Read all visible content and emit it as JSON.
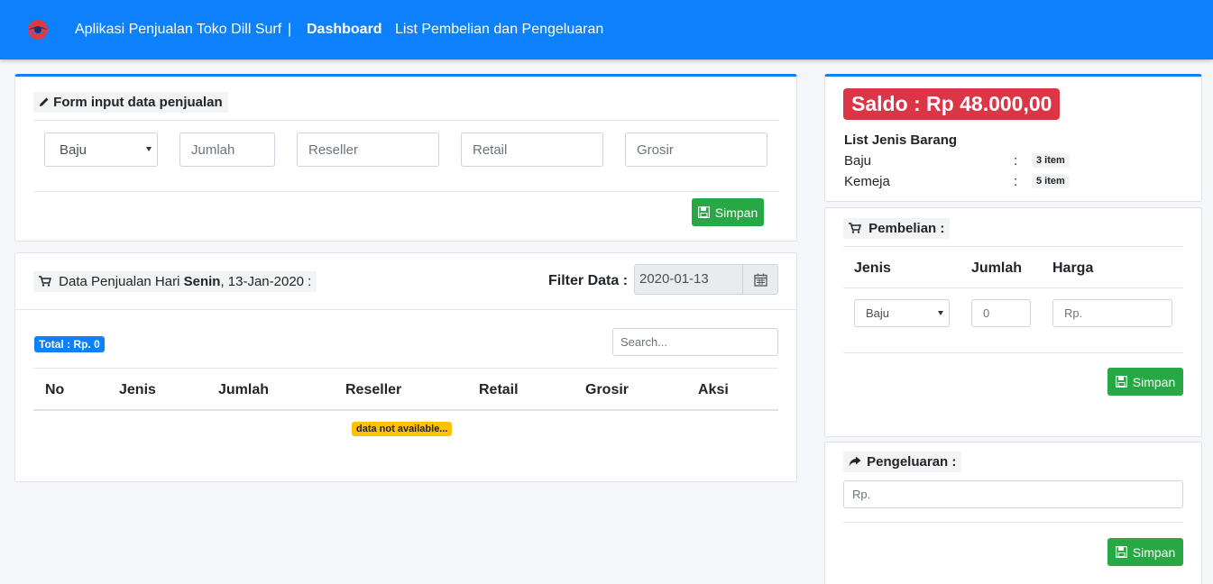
{
  "navbar": {
    "brand": "Aplikasi Penjualan Toko Dill Surf",
    "separator": "|",
    "nav_dashboard": "Dashboard",
    "nav_list": "List Pembelian dan Pengeluaran"
  },
  "form_card": {
    "title": "Form input data penjualan",
    "jenis_selected": "Baju",
    "jumlah_placeholder": "Jumlah",
    "reseller_placeholder": "Reseller",
    "retail_placeholder": "Retail",
    "grosir_placeholder": "Grosir",
    "save_label": "Simpan"
  },
  "sales_card": {
    "title_prefix": "Data Penjualan Hari",
    "day": "Senin",
    "date_suffix": ", 13-Jan-2020 :",
    "filter_label": "Filter Data :",
    "filter_value": "2020-01-13",
    "total_label": "Total : Rp. 0",
    "search_placeholder": "Search...",
    "columns": [
      "No",
      "Jenis",
      "Jumlah",
      "Reseller",
      "Retail",
      "Grosir",
      "Aksi"
    ],
    "empty_message": "data not available..."
  },
  "saldo_card": {
    "saldo": "Saldo : Rp 48.000,00",
    "list_title": "List Jenis Barang",
    "items": [
      {
        "name": "Baju",
        "colon": ":",
        "count": "3 item"
      },
      {
        "name": "Kemeja",
        "colon": ":",
        "count": "5 item"
      }
    ]
  },
  "pembelian_card": {
    "title": "Pembelian :",
    "col_jenis": "Jenis",
    "col_jumlah": "Jumlah",
    "col_harga": "Harga",
    "jenis_selected": "Baju",
    "jumlah_placeholder": "0",
    "harga_placeholder": "Rp.",
    "save_label": "Simpan"
  },
  "pengeluaran_card": {
    "title": "Pengeluaran :",
    "amount_placeholder": "Rp.",
    "save_label": "Simpan"
  },
  "colors": {
    "navbar": "#0d80fb",
    "success": "#28a745",
    "danger": "#dc3545",
    "warning": "#ffc107",
    "primary": "#0d80fb"
  }
}
